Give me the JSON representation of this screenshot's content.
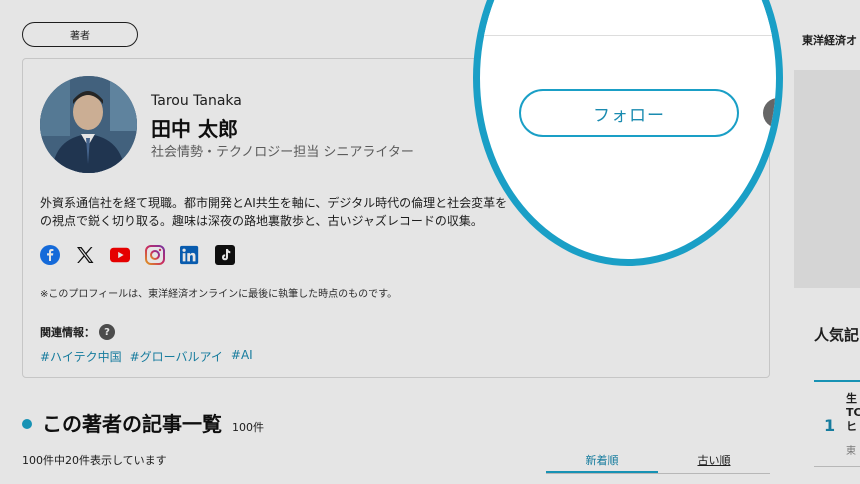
{
  "author_pill": "著者",
  "profile": {
    "name_en": "Tarou Tanaka",
    "name_ja": "田中 太郎",
    "role": "社会情勢・テクノロジー担当 シニアライター",
    "bio_line1": "外資系通信社を経て現職。都市開発とAI共生を軸に、デジタル時代の倫理と社会変革を",
    "bio_line2": "の視点で鋭く切り取る。趣味は深夜の路地裏散歩と、古いジャズレコードの収集。",
    "note": "※このプロフィールは、東洋経済オンラインに最後に執筆した時点のものです。",
    "related_label": "関連情報：",
    "related_help": "?",
    "tags": [
      "#ハイテク中国",
      "#グローバルアイ",
      "#AI"
    ],
    "socials": [
      "facebook-icon",
      "x-icon",
      "youtube-icon",
      "instagram-icon",
      "linkedin-icon",
      "tiktok-icon"
    ]
  },
  "follow_label": "フォロー",
  "articles": {
    "title": "この著者の記事一覧",
    "count": "100件",
    "showing": "100件中20件表示しています",
    "sort_new": "新着順",
    "sort_old": "古い順"
  },
  "sidebar": {
    "tag": "東洋経済オ",
    "card_title": "人気記",
    "rank": "1",
    "item_text": "生TCヒ",
    "item_sub": "東"
  },
  "colors": {
    "accent": "#1a9fc6",
    "link": "#1a8bb0"
  }
}
